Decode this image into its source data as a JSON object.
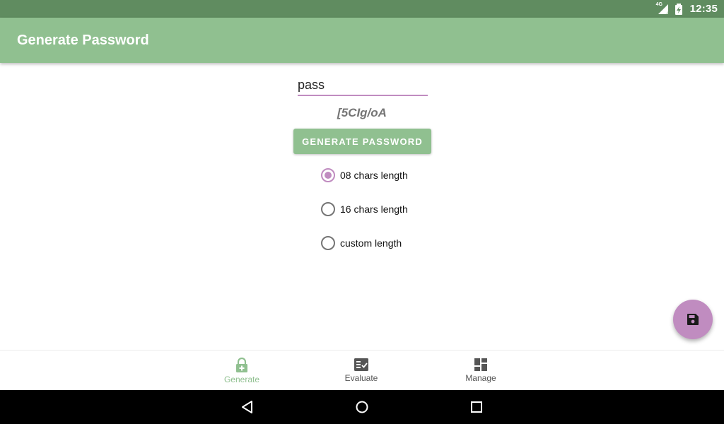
{
  "status_bar": {
    "network_label": "4G",
    "time": "12:35"
  },
  "app_bar": {
    "title": "Generate Password"
  },
  "form": {
    "name_value": "pass",
    "generated_password": "[5CIg/oA",
    "generate_button_label": "GENERATE PASSWORD",
    "length_options": [
      {
        "label": "08 chars length",
        "checked": true
      },
      {
        "label": "16 chars length",
        "checked": false
      },
      {
        "label": "custom length",
        "checked": false
      }
    ]
  },
  "fab": {
    "icon": "save-icon"
  },
  "bottom_nav": {
    "items": [
      {
        "label": "Generate",
        "icon": "lock-plus-icon",
        "active": true
      },
      {
        "label": "Evaluate",
        "icon": "checklist-icon",
        "active": false
      },
      {
        "label": "Manage",
        "icon": "dashboard-icon",
        "active": false
      }
    ]
  },
  "system_nav": {
    "buttons": [
      "back-icon",
      "home-icon",
      "recents-icon"
    ]
  },
  "colors": {
    "status_bar": "#608c60",
    "app_bar": "#90c090",
    "accent": "#c08cc0",
    "active_nav": "#90c090"
  }
}
